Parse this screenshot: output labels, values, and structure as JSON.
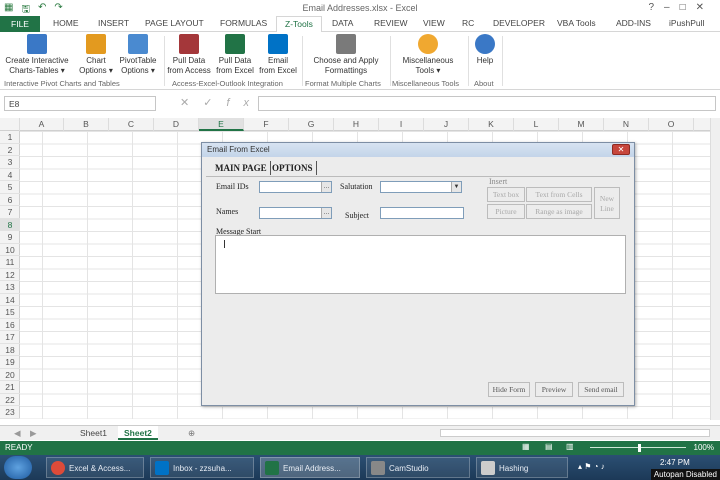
{
  "window": {
    "title": "Email Addresses.xlsx - Excel",
    "controls": [
      "?",
      "–",
      "□",
      "✕"
    ]
  },
  "tabs": [
    "FILE",
    "HOME",
    "INSERT",
    "PAGE LAYOUT",
    "FORMULAS",
    "Z-Tools",
    "DATA",
    "REVIEW",
    "VIEW",
    "RC",
    "DEVELOPER",
    "VBA Tools",
    "ADD-INS",
    "iPushPull"
  ],
  "ribbon": {
    "buttons": [
      {
        "label1": "Create Interactive",
        "label2": "Charts-Tables ▾",
        "icon_color": "#3a78c6"
      },
      {
        "label1": "Chart",
        "label2": "Options ▾",
        "icon_color": "#e39a1f"
      },
      {
        "label1": "PivotTable",
        "label2": "Options ▾",
        "icon_color": "#4a8ad0"
      },
      {
        "label1": "Pull Data",
        "label2": "from Access",
        "icon_color": "#a4373a"
      },
      {
        "label1": "Pull Data",
        "label2": "from Excel",
        "icon_color": "#217346"
      },
      {
        "label1": "Email",
        "label2": "from Excel",
        "icon_color": "#0072c6"
      },
      {
        "label1": "Choose and Apply",
        "label2": "Formattings",
        "icon_color": "#7a7a7a"
      },
      {
        "label1": "Miscellaneous",
        "label2": "Tools ▾",
        "icon_color": "#f0a830"
      },
      {
        "label1": "Help",
        "label2": "",
        "icon_color": "#3a78c6"
      }
    ],
    "groups": [
      "Interactive Pivot Charts and Tables",
      "Access-Excel-Outlook Integration",
      "Format Multiple Charts",
      "Miscellaneous Tools",
      "About"
    ]
  },
  "formula_bar": {
    "name_box": "E8",
    "fx": "fx",
    "value": ""
  },
  "columns": [
    "A",
    "B",
    "C",
    "D",
    "E",
    "F",
    "G",
    "H",
    "I",
    "J",
    "K",
    "L",
    "M",
    "N",
    "O"
  ],
  "rows": [
    "1",
    "2",
    "3",
    "4",
    "5",
    "6",
    "7",
    "8",
    "9",
    "10",
    "11",
    "12",
    "13",
    "14",
    "15",
    "16",
    "17",
    "18",
    "19",
    "20",
    "21",
    "22",
    "23"
  ],
  "selected": {
    "column": "E",
    "row": "8"
  },
  "sheets": [
    "Sheet1",
    "Sheet2"
  ],
  "active_sheet": "Sheet2",
  "status": {
    "ready": "READY",
    "zoom": "100%"
  },
  "dialog": {
    "title": "Email From Excel",
    "close": "✕",
    "tabs": [
      "MAIN PAGE",
      "OPTIONS"
    ],
    "labels": {
      "email_ids": "Email IDs",
      "names": "Names",
      "salutation": "Salutation",
      "subject": "Subject",
      "insert": "Insert",
      "message_start": "Message Start"
    },
    "insert_buttons": {
      "text_box": "Text box",
      "text_from_cells": "Text from Cells",
      "new_line": "New Line",
      "picture": "Picture",
      "range_as_image": "Range as image"
    },
    "footer_buttons": {
      "hide_form": "Hide Form",
      "preview": "Preview",
      "send_email": "Send email"
    }
  },
  "taskbar": {
    "items": [
      {
        "label": "Excel & Access...",
        "icon_color": "#dd4b39"
      },
      {
        "label": "Inbox - zzsuha...",
        "icon_color": "#0072c6"
      },
      {
        "label": "Email Address...",
        "icon_color": "#217346"
      },
      {
        "label": "CamStudio",
        "icon_color": "#888888"
      },
      {
        "label": "Hashing",
        "icon_color": "#cccccc"
      }
    ],
    "clock": "2:47 PM",
    "autopan": "Autopan Disabled"
  }
}
